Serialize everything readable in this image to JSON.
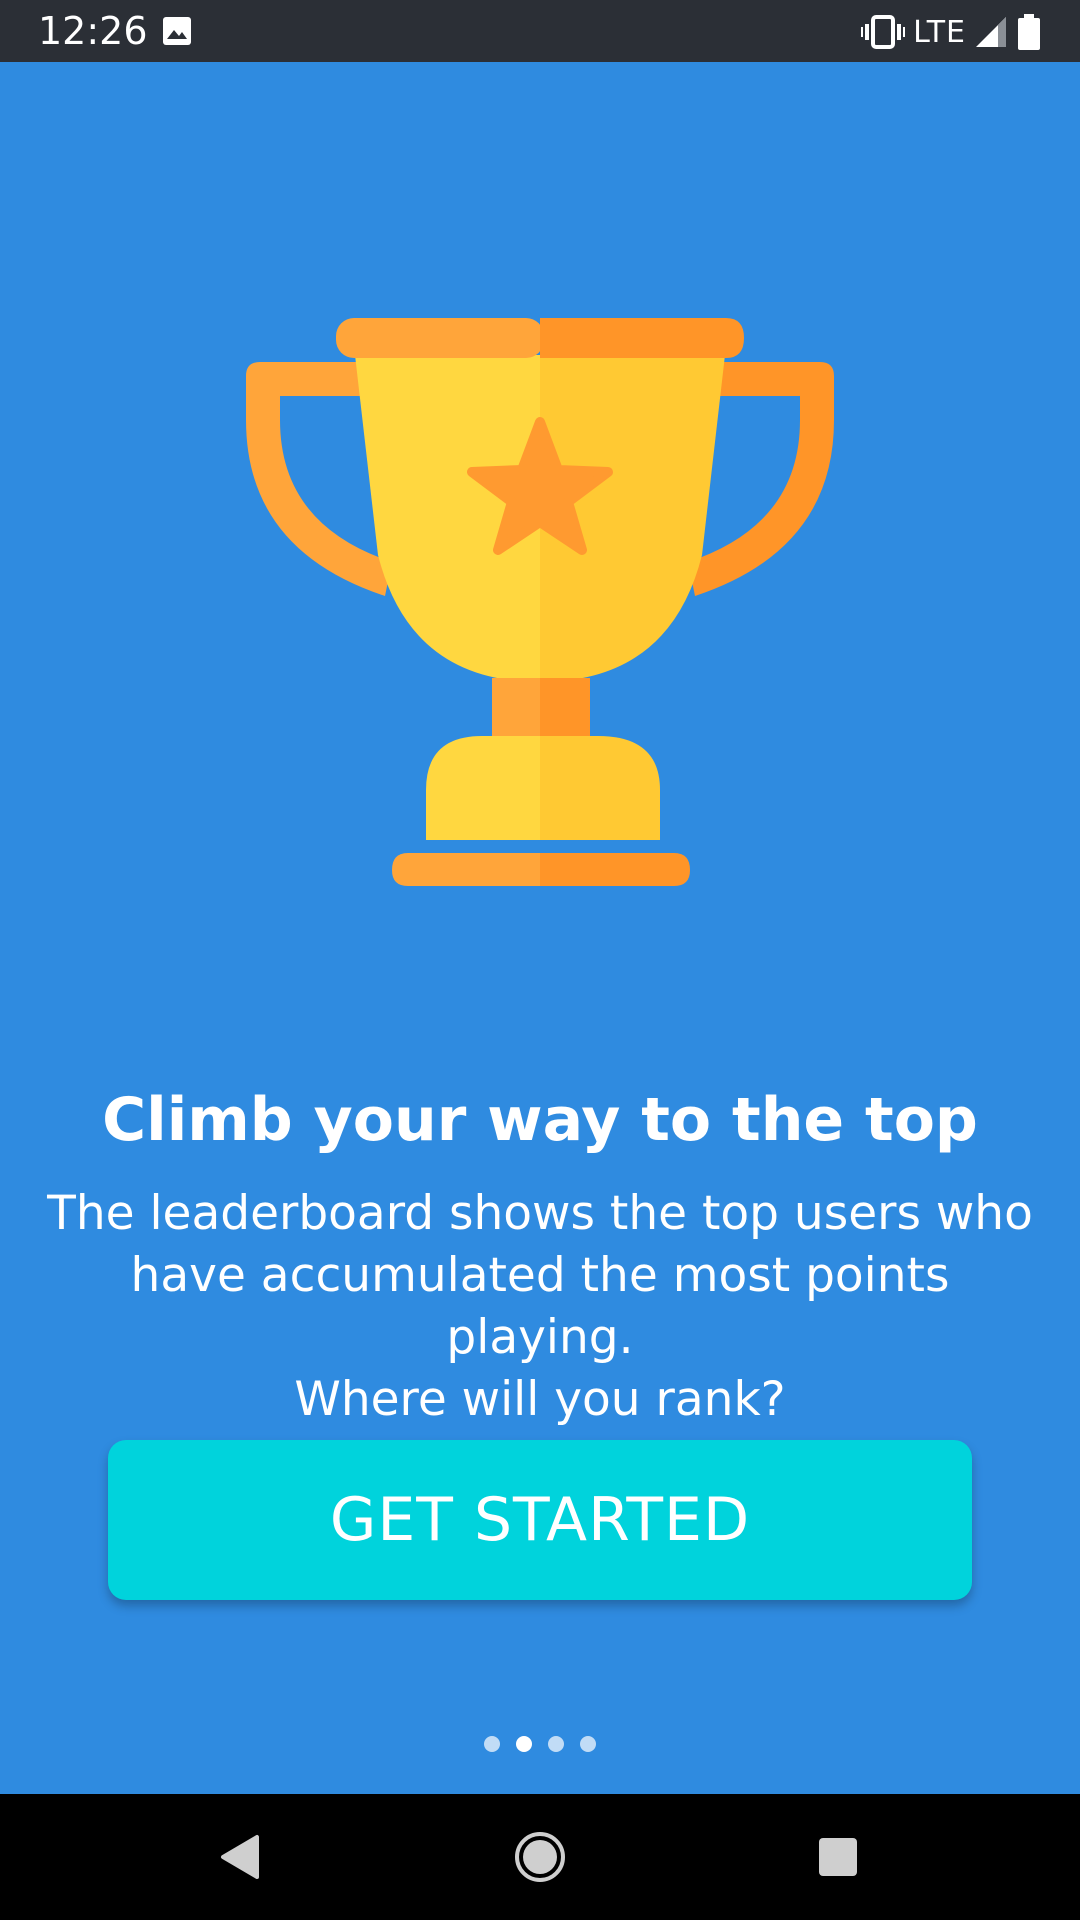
{
  "status_bar": {
    "time": "12:26",
    "network": "LTE",
    "icons": [
      "image-icon",
      "vibrate-icon",
      "signal-icon",
      "battery-icon"
    ]
  },
  "illustration": {
    "icon": "trophy-with-star-icon",
    "colors": {
      "cup_light": "#ffd740",
      "cup_dark": "#ffc933",
      "handle_light": "#ffa53a",
      "handle_dark": "#ff9528",
      "star": "#ff9a30"
    }
  },
  "onboarding": {
    "headline": "Climb your way to the top",
    "body_line1": "The leaderboard shows the top users who",
    "body_line2": "have accumulated the most points playing.",
    "body_line3": "Where will you rank?",
    "cta_label": "GET STARTED",
    "page_count": 4,
    "active_page": 2
  },
  "nav_bar": {
    "icons": [
      "back-icon",
      "home-icon",
      "recents-icon"
    ]
  },
  "colors": {
    "background": "#2f8be0",
    "button": "#00d3dc",
    "status_bar": "#2b2f36"
  }
}
